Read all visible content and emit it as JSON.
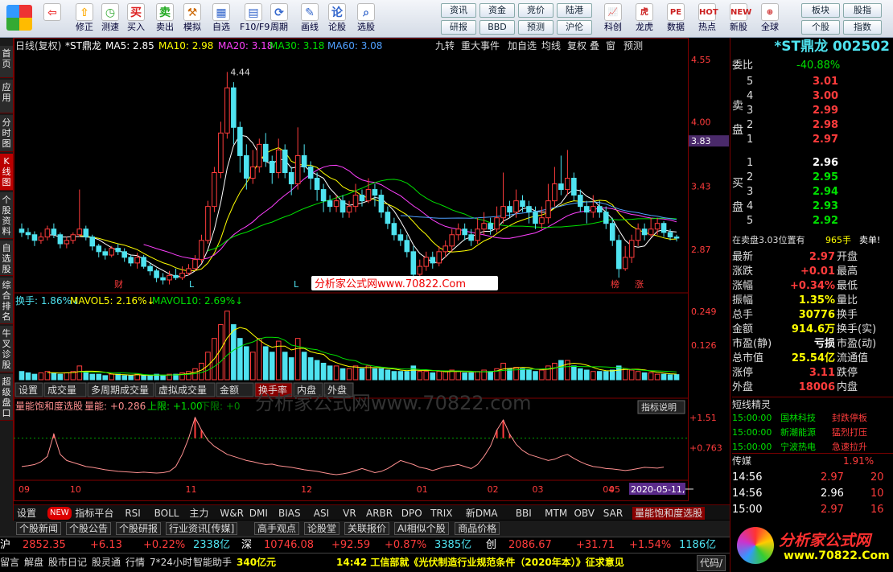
{
  "toolbar": {
    "items": [
      {
        "id": "back",
        "label": ""
      },
      {
        "id": "up",
        "label": "修正"
      },
      {
        "id": "test",
        "label": "测速"
      },
      {
        "id": "buy",
        "label": "买入"
      },
      {
        "id": "sell",
        "label": "卖出"
      },
      {
        "id": "sim",
        "label": "模拟"
      },
      {
        "id": "fav",
        "label": "自选"
      },
      {
        "id": "f10",
        "label": "F10/F9"
      },
      {
        "id": "period",
        "label": "周期"
      },
      {
        "id": "draw",
        "label": "画线"
      },
      {
        "id": "lunshu",
        "label": "论股"
      },
      {
        "id": "select",
        "label": "选股"
      }
    ],
    "btns2": [
      "资讯",
      "资金",
      "竞价",
      "陆港",
      "研报",
      "BBD",
      "预测",
      "沪伦"
    ],
    "icons2": [
      {
        "id": "kechuang",
        "label": "科创"
      },
      {
        "id": "longhu",
        "label": "龙虎"
      },
      {
        "id": "data",
        "label": "数据"
      },
      {
        "id": "hot",
        "label": "热点"
      },
      {
        "id": "newstock",
        "label": "新股"
      },
      {
        "id": "global",
        "label": "全球"
      }
    ],
    "btns3": [
      "板块",
      "股指",
      "个股",
      "指数"
    ]
  },
  "sidetabs": [
    "首页",
    "应用",
    "分时图",
    "K线图",
    "个股资料",
    "自选股",
    "综合排名",
    "牛叉诊股",
    "超级盘口"
  ],
  "chart": {
    "title": "日线(复权)",
    "stock": "*ST鼎龙",
    "ma": [
      {
        "name": "MA5",
        "value": "2.85",
        "color": "#ffffff"
      },
      {
        "name": "MA10",
        "value": "2.98",
        "color": "#ffff00"
      },
      {
        "name": "MA20",
        "value": "3.18",
        "color": "#ff40ff"
      },
      {
        "name": "MA30",
        "value": "3.18",
        "color": "#00e000"
      },
      {
        "name": "MA60",
        "value": "3.08",
        "color": "#4fa0ff"
      }
    ],
    "menu": [
      "九转",
      "重大事件",
      "加自选",
      "均线",
      "复权",
      "叠",
      "窗",
      "预测"
    ],
    "price_axis": [
      "4.55",
      "4.00",
      "3.43",
      "2.87"
    ],
    "current_price": "3.83",
    "peak": "4.44",
    "event_labels": [
      "财",
      "L",
      "L",
      "L",
      "榜",
      "涨"
    ],
    "watermark": "分析家公式网www.70822.Com",
    "watermark2": "分析家公式网www.70822.com",
    "vol_legend": [
      {
        "name": "换手",
        "value": "1.86%",
        "color": "#4fe3f0"
      },
      {
        "name": "MAVOL5",
        "value": "2.16%",
        "color": "#ffff00"
      },
      {
        "name": "MAVOL10",
        "value": "2.69%",
        "color": "#00e000"
      }
    ],
    "vol_axis": [
      "0.249",
      "0.126"
    ],
    "vol_tabs": [
      "设置",
      "成交量",
      "多周期成交量",
      "虚拟成交量",
      "金额",
      "换手率",
      "内盘",
      "外盘"
    ],
    "ind_legend": {
      "name": "量能饱和度选股",
      "l1": "量能: +0.286",
      "l2": "上限: +1.00",
      "l3": "下限: +0"
    },
    "ind_btn": "指标说明",
    "ind_axis": [
      "+1.51",
      "+0.763"
    ],
    "months": [
      "09",
      "10",
      "11",
      "12",
      "01",
      "02",
      "03",
      "04",
      "05"
    ],
    "date_tip": "2020-05-11,一"
  },
  "chart_data": {
    "type": "candlestick",
    "candles": [
      [
        3.05,
        3.02,
        3.1,
        2.98
      ],
      [
        3.02,
        3.0,
        3.06,
        2.96
      ],
      [
        3.0,
        2.95,
        3.03,
        2.9
      ],
      [
        2.95,
        2.98,
        3.02,
        2.92
      ],
      [
        2.98,
        3.05,
        3.08,
        2.95
      ],
      [
        3.05,
        3.0,
        3.1,
        2.97
      ],
      [
        3.0,
        2.92,
        3.02,
        2.88
      ],
      [
        2.92,
        2.95,
        2.98,
        2.88
      ],
      [
        2.95,
        3.0,
        3.02,
        2.92
      ],
      [
        3.0,
        3.05,
        3.4,
        2.98
      ],
      [
        3.05,
        2.98,
        3.08,
        2.95
      ],
      [
        2.98,
        2.9,
        3.0,
        2.86
      ],
      [
        2.9,
        2.85,
        2.92,
        2.8
      ],
      [
        2.85,
        2.82,
        2.88,
        2.78
      ],
      [
        2.82,
        2.88,
        2.9,
        2.8
      ],
      [
        2.88,
        2.85,
        2.92,
        2.82
      ],
      [
        2.85,
        2.8,
        2.88,
        2.76
      ],
      [
        2.8,
        2.75,
        2.82,
        2.72
      ],
      [
        2.75,
        2.8,
        2.84,
        2.7
      ],
      [
        2.8,
        2.72,
        2.82,
        2.7
      ],
      [
        2.72,
        2.68,
        2.75,
        2.64
      ],
      [
        2.68,
        2.62,
        2.7,
        2.58
      ],
      [
        2.62,
        2.6,
        2.66,
        2.56
      ],
      [
        2.6,
        2.64,
        2.68,
        2.56
      ],
      [
        2.64,
        2.62,
        2.7,
        2.6
      ],
      [
        2.62,
        2.66,
        2.72,
        2.6
      ],
      [
        2.66,
        2.7,
        2.74,
        2.64
      ],
      [
        2.7,
        2.78,
        2.82,
        2.68
      ],
      [
        2.78,
        2.95,
        3.0,
        2.75
      ],
      [
        2.95,
        3.25,
        3.3,
        2.92
      ],
      [
        3.25,
        3.55,
        3.6,
        3.2
      ],
      [
        3.55,
        3.9,
        4.0,
        3.5
      ],
      [
        3.9,
        4.3,
        4.44,
        3.85
      ],
      [
        4.3,
        3.95,
        4.35,
        3.8
      ],
      [
        3.95,
        3.7,
        4.0,
        3.55
      ],
      [
        3.7,
        3.5,
        3.8,
        3.4
      ],
      [
        3.5,
        3.6,
        3.75,
        3.45
      ],
      [
        3.6,
        3.8,
        3.85,
        3.55
      ],
      [
        3.8,
        3.65,
        3.9,
        3.6
      ],
      [
        3.65,
        3.55,
        3.7,
        3.45
      ],
      [
        3.55,
        3.75,
        3.85,
        3.5
      ],
      [
        3.75,
        3.55,
        3.8,
        3.5
      ],
      [
        3.55,
        3.45,
        3.6,
        3.35
      ],
      [
        3.45,
        3.7,
        3.95,
        3.4
      ],
      [
        3.7,
        3.6,
        3.8,
        3.55
      ],
      [
        3.6,
        3.5,
        3.65,
        3.4
      ],
      [
        3.5,
        3.4,
        3.55,
        3.3
      ],
      [
        3.4,
        3.3,
        3.45,
        3.2
      ],
      [
        3.3,
        3.25,
        3.35,
        3.2
      ],
      [
        3.25,
        3.3,
        3.35,
        3.2
      ],
      [
        3.3,
        3.2,
        3.35,
        3.15
      ],
      [
        3.2,
        3.25,
        3.3,
        3.15
      ],
      [
        3.25,
        3.35,
        3.45,
        3.2
      ],
      [
        3.35,
        3.3,
        3.4,
        3.25
      ],
      [
        3.3,
        3.4,
        3.5,
        3.28
      ],
      [
        3.4,
        3.35,
        3.45,
        3.25
      ],
      [
        3.35,
        3.2,
        3.4,
        3.15
      ],
      [
        3.2,
        3.1,
        3.25,
        3.05
      ],
      [
        3.1,
        3.0,
        3.15,
        2.95
      ],
      [
        3.0,
        2.95,
        3.05,
        2.9
      ],
      [
        2.95,
        2.85,
        3.0,
        2.8
      ],
      [
        2.85,
        2.65,
        2.9,
        2.6
      ],
      [
        2.65,
        2.72,
        2.78,
        2.62
      ],
      [
        2.72,
        2.8,
        2.85,
        2.68
      ],
      [
        2.8,
        2.75,
        2.85,
        2.7
      ],
      [
        2.75,
        2.85,
        2.9,
        2.72
      ],
      [
        2.85,
        2.9,
        2.95,
        2.8
      ],
      [
        2.9,
        3.0,
        3.05,
        2.85
      ],
      [
        3.0,
        3.05,
        3.1,
        2.95
      ],
      [
        3.05,
        3.0,
        3.1,
        2.95
      ],
      [
        3.0,
        2.95,
        3.05,
        2.9
      ],
      [
        2.95,
        3.05,
        3.15,
        2.92
      ],
      [
        3.05,
        3.1,
        3.2,
        3.0
      ],
      [
        3.1,
        3.05,
        3.15,
        3.0
      ],
      [
        3.05,
        3.15,
        3.25,
        3.02
      ],
      [
        3.15,
        3.25,
        3.55,
        3.1
      ],
      [
        3.25,
        3.2,
        3.3,
        3.15
      ],
      [
        3.2,
        3.3,
        3.4,
        3.15
      ],
      [
        3.3,
        3.25,
        3.35,
        3.2
      ],
      [
        3.25,
        3.2,
        3.3,
        3.1
      ],
      [
        3.2,
        3.1,
        3.25,
        3.05
      ],
      [
        3.1,
        3.15,
        3.25,
        3.05
      ],
      [
        3.15,
        3.3,
        3.45,
        3.1
      ],
      [
        3.3,
        3.45,
        3.6,
        3.25
      ],
      [
        3.45,
        3.4,
        3.7,
        3.35
      ],
      [
        3.4,
        3.5,
        3.75,
        3.35
      ],
      [
        3.5,
        3.35,
        3.55,
        3.3
      ],
      [
        3.35,
        3.25,
        3.4,
        3.2
      ],
      [
        3.25,
        3.2,
        3.3,
        3.1
      ],
      [
        3.2,
        3.25,
        3.35,
        3.15
      ],
      [
        3.25,
        3.2,
        3.3,
        3.15
      ],
      [
        3.2,
        3.1,
        3.25,
        3.05
      ],
      [
        3.1,
        2.95,
        3.15,
        2.9
      ],
      [
        2.95,
        2.7,
        3.0,
        2.62
      ],
      [
        2.7,
        2.8,
        2.9,
        2.68
      ],
      [
        2.8,
        2.95,
        3.0,
        2.75
      ],
      [
        2.95,
        3.05,
        3.1,
        2.9
      ],
      [
        3.05,
        3.0,
        3.1,
        2.95
      ],
      [
        3.0,
        3.05,
        3.15,
        2.98
      ],
      [
        3.05,
        3.1,
        3.15,
        3.0
      ],
      [
        3.1,
        3.02,
        3.12,
        2.98
      ],
      [
        3.02,
        2.98,
        3.05,
        2.95
      ],
      [
        2.98,
        2.97,
        3.0,
        2.94
      ]
    ],
    "turnover": [
      0.03,
      0.025,
      0.02,
      0.025,
      0.03,
      0.025,
      0.02,
      0.025,
      0.03,
      0.05,
      0.03,
      0.02,
      0.02,
      0.015,
      0.02,
      0.02,
      0.015,
      0.015,
      0.02,
      0.015,
      0.015,
      0.02,
      0.015,
      0.02,
      0.02,
      0.025,
      0.03,
      0.04,
      0.06,
      0.1,
      0.15,
      0.2,
      0.249,
      0.2,
      0.15,
      0.12,
      0.1,
      0.15,
      0.12,
      0.1,
      0.14,
      0.1,
      0.08,
      0.15,
      0.1,
      0.08,
      0.07,
      0.06,
      0.05,
      0.05,
      0.04,
      0.04,
      0.05,
      0.04,
      0.05,
      0.04,
      0.04,
      0.035,
      0.03,
      0.03,
      0.03,
      0.05,
      0.03,
      0.03,
      0.025,
      0.03,
      0.03,
      0.035,
      0.03,
      0.025,
      0.025,
      0.03,
      0.035,
      0.03,
      0.04,
      0.06,
      0.04,
      0.045,
      0.04,
      0.035,
      0.03,
      0.035,
      0.05,
      0.06,
      0.07,
      0.07,
      0.05,
      0.04,
      0.035,
      0.03,
      0.03,
      0.03,
      0.035,
      0.05,
      0.04,
      0.035,
      0.03,
      0.025,
      0.025,
      0.02,
      0.02,
      0.018,
      0.0186
    ],
    "indicator": [
      0.3,
      0.32,
      0.35,
      0.42,
      0.55,
      1.1,
      0.6,
      0.45,
      0.4,
      0.35,
      0.3,
      0.28,
      0.25,
      0.22,
      0.2,
      0.18,
      0.17,
      0.16,
      0.15,
      0.16,
      0.15,
      0.14,
      0.15,
      0.18,
      0.3,
      0.6,
      1.0,
      1.51,
      1.2,
      0.95,
      0.8,
      0.7,
      0.6,
      0.55,
      0.5,
      0.45,
      0.42,
      0.38,
      0.35,
      0.36,
      0.32,
      0.3,
      0.28,
      0.25,
      0.22,
      0.2,
      0.18,
      0.15,
      0.12,
      0.1,
      0.12,
      0.15,
      0.2,
      0.25,
      0.2,
      0.15,
      0.18,
      0.25,
      0.35,
      0.45,
      0.4,
      0.35,
      0.28,
      0.25,
      0.2,
      0.25,
      0.3,
      0.32,
      0.35,
      0.3,
      0.25,
      0.35,
      0.55,
      0.8,
      1.2,
      1.45,
      1.1,
      0.85,
      0.7,
      0.6,
      0.55,
      0.5,
      0.45,
      0.48,
      0.55,
      0.6,
      0.5,
      0.42,
      0.35,
      0.3,
      0.28,
      0.25,
      0.24,
      0.22,
      0.2,
      0.22,
      0.25,
      0.28,
      0.27,
      0.26,
      0.286
    ],
    "ylim": [
      2.5,
      4.6
    ]
  },
  "quote": {
    "name": "*ST鼎龙",
    "code": "002502",
    "weibi_label": "委比",
    "weibi": "-40.88%",
    "sell_label": "卖盘",
    "buy_label": "买盘",
    "asks": [
      {
        "n": "5",
        "p": "3.01"
      },
      {
        "n": "4",
        "p": "3.00"
      },
      {
        "n": "3",
        "p": "2.99"
      },
      {
        "n": "2",
        "p": "2.98"
      },
      {
        "n": "1",
        "p": "2.97"
      }
    ],
    "bids": [
      {
        "n": "1",
        "p": "2.96"
      },
      {
        "n": "2",
        "p": "2.95"
      },
      {
        "n": "3",
        "p": "2.94"
      },
      {
        "n": "4",
        "p": "2.93"
      },
      {
        "n": "5",
        "p": "2.92"
      }
    ],
    "position_text": "在卖盘3.03位置有",
    "position_vol": "965手",
    "position_side": "卖单!",
    "stats": [
      {
        "l": "最新",
        "v": "2.97",
        "vc": "red",
        "r": "开盘",
        "rv": ""
      },
      {
        "l": "涨跌",
        "v": "+0.01",
        "vc": "red",
        "r": "最高",
        "rv": ""
      },
      {
        "l": "涨幅",
        "v": "+0.34%",
        "vc": "red",
        "r": "最低",
        "rv": ""
      },
      {
        "l": "振幅",
        "v": "1.35%",
        "vc": "yel",
        "r": "量比",
        "rv": ""
      },
      {
        "l": "总手",
        "v": "30776",
        "vc": "yel",
        "r": "换手",
        "rv": ""
      },
      {
        "l": "金额",
        "v": "914.6万",
        "vc": "yel",
        "r": "换手(实)",
        "rv": ""
      },
      {
        "l": "市盈(静)",
        "v": "亏损",
        "vc": "wht",
        "r": "市盈(动)",
        "rv": ""
      },
      {
        "l": "总市值",
        "v": "25.54亿",
        "vc": "yel",
        "r": "流通值",
        "rv": ""
      },
      {
        "l": "涨停",
        "v": "3.11",
        "vc": "red",
        "r": "跌停",
        "rv": ""
      },
      {
        "l": "外盘",
        "v": "18006",
        "vc": "red",
        "r": "内盘",
        "rv": ""
      }
    ],
    "short_title": "短线精灵",
    "short": [
      {
        "t": "15:00:00",
        "s": "国林科技",
        "e": "封跌停板"
      },
      {
        "t": "15:00:00",
        "s": "新潮能源",
        "e": "猛烈打压"
      },
      {
        "t": "15:00:00",
        "s": "宁波热电",
        "e": "急速拉升"
      }
    ],
    "sector": "传媒",
    "sector_pct": "1.91%",
    "ticks": [
      {
        "t": "14:56",
        "p": "2.97",
        "v": "20"
      },
      {
        "t": "14:56",
        "p": "2.96",
        "v": "10"
      },
      {
        "t": "15:00",
        "p": "2.97",
        "v": "16"
      }
    ]
  },
  "bottom_tabs": [
    "设置",
    "NEW",
    "指标平台",
    "RSI",
    "BOLL",
    "主力",
    "W&R",
    "DMI",
    "BIAS",
    "ASI",
    "VR",
    "ARBR",
    "DPO",
    "TRIX",
    "新DMA",
    "BBI",
    "MTM",
    "OBV",
    "SAR",
    "量能饱和度选股"
  ],
  "news_tabs": [
    "个股新闻",
    "个股公告",
    "个股研报",
    "行业资讯[传媒]",
    "高手观点",
    "论股堂",
    "关联报价",
    "AI相似个股",
    "商品价格"
  ],
  "index_bar": [
    {
      "n": "沪",
      "v": "2852.35",
      "c": "+6.13",
      "p": "+0.22%",
      "a": "2338亿"
    },
    {
      "n": "深",
      "v": "10746.08",
      "c": "+92.59",
      "p": "+0.87%",
      "a": "3385亿"
    },
    {
      "n": "创",
      "v": "2086.67",
      "c": "+31.71",
      "p": "+1.54%",
      "a": "1186亿"
    }
  ],
  "status": {
    "items": [
      "留言",
      "解盘",
      "股市日记",
      "股灵通",
      "行情",
      "7*24小时",
      "智能助手"
    ],
    "amount": "340亿元",
    "news": "14:42 工信部就《光伏制造行业规范条件（2020年本）》征求意见",
    "right": "代码/"
  },
  "logo": {
    "text": "分析家公式网",
    "url": "www.70822.Com"
  }
}
